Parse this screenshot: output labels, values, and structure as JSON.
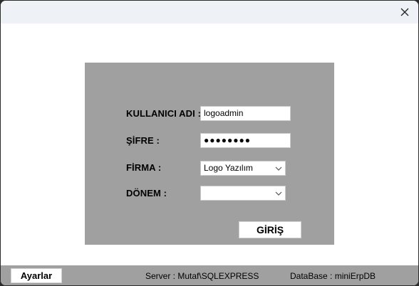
{
  "window": {
    "close_icon": "close-icon"
  },
  "form": {
    "username_label": "KULLANICI ADI :",
    "username_value": "logoadmin",
    "password_label": "ŞİFRE :",
    "password_value": "●●●●●●●●",
    "company_label": "FİRMA :",
    "company_value": "Logo Yazılım",
    "period_label": "DÖNEM :",
    "period_value": "",
    "login_button": "GİRİŞ"
  },
  "statusbar": {
    "settings_button": "Ayarlar",
    "server_text": "Server : Mutaf\\SQLEXPRESS",
    "database_text": "DataBase : miniErpDB"
  },
  "colors": {
    "panel": "#a0a0a0",
    "titlebar": "#eef2f6",
    "window": "#ffffff"
  }
}
